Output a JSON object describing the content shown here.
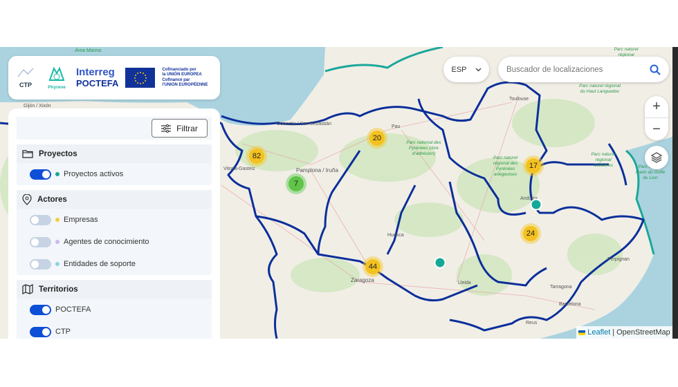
{
  "logos": {
    "ctp": "CTP",
    "phyrene": "Phyrene",
    "interreg_line1": "Interreg",
    "interreg_line2": "POCTEFA",
    "eu_text_es_1": "Cofinanciado por",
    "eu_text_es_2": "la UNIÓN EUROPEA",
    "eu_text_fr_1": "Cofinancé par",
    "eu_text_fr_2": "l'UNION EUROPÉENNE"
  },
  "panel": {
    "filter_label": "Filtrar",
    "sections": [
      {
        "title": "Proyectos",
        "icon": "folder-icon",
        "items": [
          {
            "label": "Proyectos activos",
            "on": true,
            "color": "#15a897"
          }
        ]
      },
      {
        "title": "Actores",
        "icon": "map-pin-icon",
        "items": [
          {
            "label": "Empresas",
            "on": false,
            "color": "#f4cf3a"
          },
          {
            "label": "Agentes de conocimiento",
            "on": false,
            "color": "#cdb8ee"
          },
          {
            "label": "Entidades de soporte",
            "on": false,
            "color": "#8ed3e4"
          }
        ]
      },
      {
        "title": "Territorios",
        "icon": "map-icon",
        "items": [
          {
            "label": "POCTEFA",
            "on": true
          },
          {
            "label": "CTP",
            "on": true
          }
        ]
      }
    ]
  },
  "controls": {
    "language": "ESP",
    "search_placeholder": "Buscador de localizaciones",
    "zoom_in": "+",
    "zoom_out": "−"
  },
  "map": {
    "clusters": [
      {
        "count": "82",
        "color": "yellow"
      },
      {
        "count": "20",
        "color": "yellow"
      },
      {
        "count": "7",
        "color": "green"
      },
      {
        "count": "17",
        "color": "yellow"
      },
      {
        "count": "24",
        "color": "yellow"
      },
      {
        "count": "44",
        "color": "yellow"
      }
    ],
    "labels": [
      "Área Marina",
      "Toulouse",
      "Pamplona / Iruña",
      "Vitoria-Gasteiz",
      "Zaragoza",
      "Huesca",
      "Lleida",
      "Barcelona",
      "Tarragona",
      "Pau",
      "Andorra",
      "Gijón / Xixón",
      "Donostia / San Sebastián",
      "Reus",
      "Perpignan"
    ],
    "parks": [
      "Parc naturel régional du Haut Languedoc",
      "Parc national des Pyrénées (Aire d'adhésion)",
      "Parc naturel régional des Pyrénées ariégeoises",
      "Parc naturel régional Corbières",
      "Parc naturel marin du Golfe du Lion",
      "Parc naturel régional"
    ]
  },
  "attribution": {
    "leaflet": "Leaflet",
    "separator": "|",
    "osm": "OpenStreetMap"
  },
  "colors": {
    "accent": "#0d4fd6",
    "boundary": "#0a2f9a",
    "project": "#15a897",
    "cluster": "#f4c21f"
  }
}
